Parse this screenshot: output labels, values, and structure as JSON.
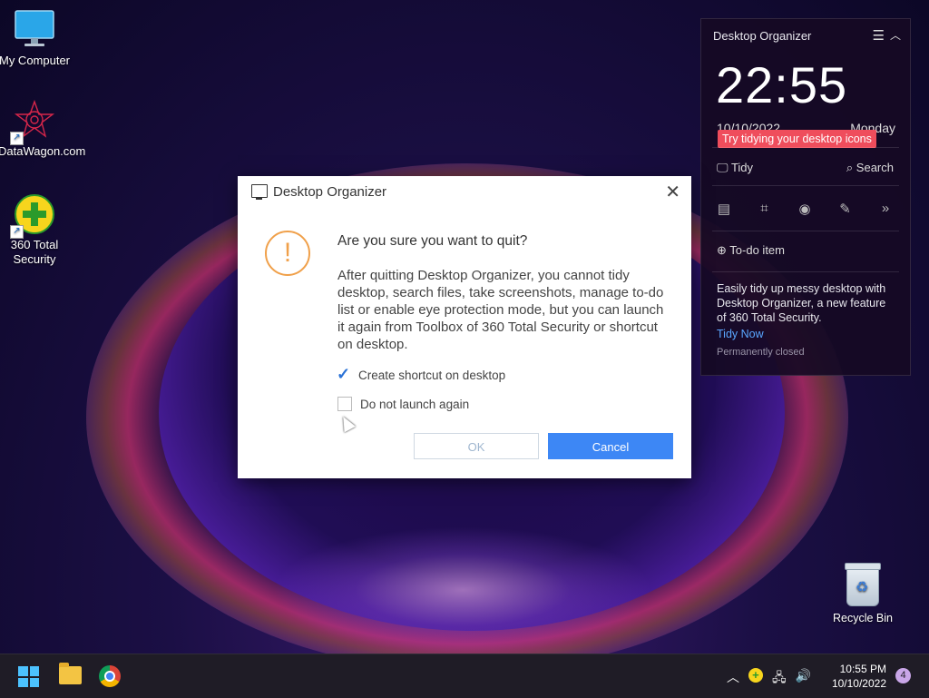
{
  "desktop": {
    "icons": [
      {
        "label": "My Computer"
      },
      {
        "label": "DataWagon.com"
      },
      {
        "label": "360 Total Security"
      }
    ],
    "recycle_bin": {
      "label": "Recycle Bin"
    }
  },
  "widget": {
    "title": "Desktop Organizer",
    "time": "22:55",
    "date": "10/10/2022",
    "day": "Monday",
    "tip": "Try tidying your desktop icons",
    "tidy_label": "Tidy",
    "search_label": "Search",
    "todo_label": "To-do item",
    "description": "Easily tidy up messy desktop with Desktop Organizer, a new feature of 360 Total Security.",
    "tidy_now": "Tidy Now",
    "permanently_closed": "Permanently closed"
  },
  "dialog": {
    "title": "Desktop Organizer",
    "question": "Are you sure you want to quit?",
    "body": "After quitting Desktop Organizer, you cannot tidy desktop, search files, take screenshots, manage to-do list or enable eye protection mode, but you can launch it again from Toolbox of 360 Total Security or shortcut on desktop.",
    "checkbox_shortcut": {
      "label": "Create shortcut on desktop",
      "checked": true
    },
    "checkbox_no_launch": {
      "label": "Do not launch again",
      "checked": false
    },
    "ok_label": "OK",
    "cancel_label": "Cancel"
  },
  "taskbar": {
    "time": "10:55 PM",
    "date": "10/10/2022",
    "notification_count": "4"
  },
  "colors": {
    "accent_blue": "#3d87f5",
    "tip_red": "#ef4d5c",
    "warning_orange": "#f0a04a"
  }
}
